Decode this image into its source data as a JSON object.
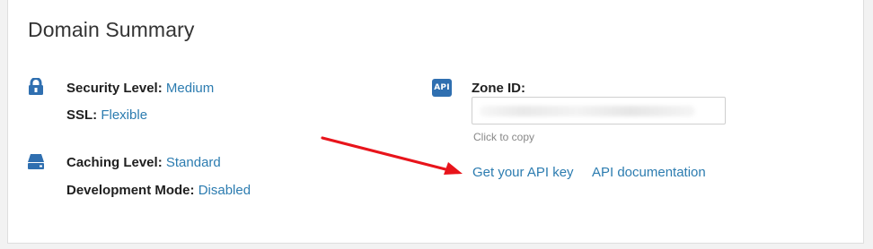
{
  "card": {
    "title": "Domain Summary"
  },
  "security": {
    "label": "Security Level:",
    "value": "Medium",
    "icon": "lock-icon"
  },
  "ssl": {
    "label": "SSL:",
    "value": "Flexible"
  },
  "caching": {
    "label": "Caching Level:",
    "value": "Standard",
    "icon": "drive-icon"
  },
  "development": {
    "label": "Development Mode:",
    "value": "Disabled"
  },
  "zone": {
    "badge": "API",
    "label": "Zone ID:",
    "hint": "Click to copy"
  },
  "links": {
    "api_key": "Get your API key",
    "api_docs": "API documentation"
  },
  "colors": {
    "link": "#2c7cb0",
    "icon": "#2f6fb0",
    "annotation_arrow": "#e8141b"
  }
}
